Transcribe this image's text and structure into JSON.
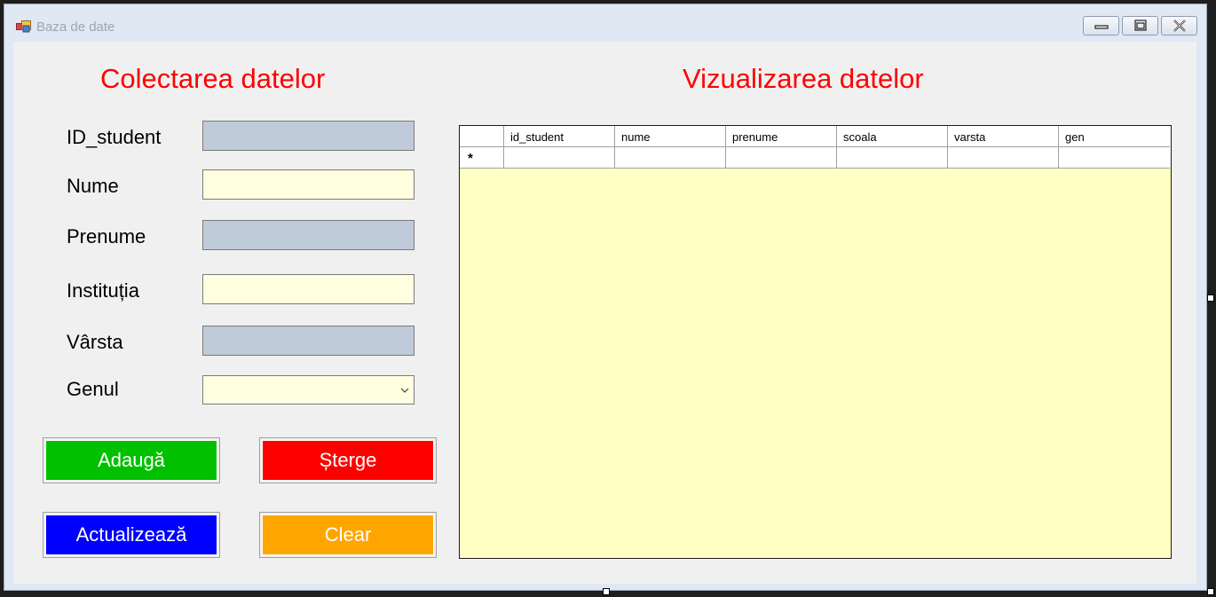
{
  "window": {
    "title": "Baza de date",
    "icon": "app-form-icon"
  },
  "colectare": {
    "heading": "Colectarea datelor",
    "labels": {
      "id": "ID_student",
      "nume": "Nume",
      "prenume": "Prenume",
      "institutia": "Instituția",
      "varsta": "Vârsta",
      "genul": "Genul"
    },
    "values": {
      "id": "",
      "nume": "",
      "prenume": "",
      "institutia": "",
      "varsta": "",
      "genul": ""
    }
  },
  "buttons": {
    "adauga": "Adaugă",
    "sterge": "Șterge",
    "actualizeaza": "Actualizează",
    "clear": "Clear"
  },
  "colors": {
    "heading": "#ff0000",
    "adauga": "#00c000",
    "sterge": "#ff0000",
    "actualizeaza": "#0000ff",
    "clear": "#ffa500",
    "grid_background": "#ffffc4",
    "readonly_field": "#c0cbd9",
    "editable_field": "#ffffe0"
  },
  "vizualizare": {
    "heading": "Vizualizarea datelor",
    "columns": [
      "id_student",
      "nume",
      "prenume",
      "scoala",
      "varsta",
      "gen"
    ],
    "new_row_marker": "*"
  }
}
